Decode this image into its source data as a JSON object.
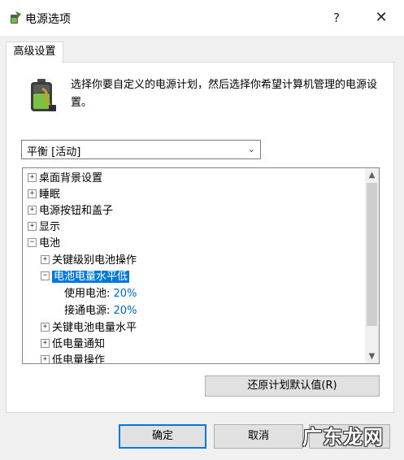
{
  "window": {
    "title": "电源选项",
    "help_label": "?",
    "close_label": "✕"
  },
  "tabs": [
    {
      "label": "高级设置"
    }
  ],
  "description": "选择你要自定义的电源计划，然后选择你希望计算机管理的电源设置。",
  "plan_select": {
    "value": "平衡 [活动]"
  },
  "tree": {
    "items": [
      {
        "label": "桌面背景设置",
        "toggle": "+"
      },
      {
        "label": "睡眠",
        "toggle": "+"
      },
      {
        "label": "电源按钮和盖子",
        "toggle": "+"
      },
      {
        "label": "显示",
        "toggle": "+"
      },
      {
        "label": "电池",
        "toggle": "−"
      },
      {
        "label": "关键级别电池操作",
        "toggle": "+"
      },
      {
        "label": "电池电量水平低",
        "toggle": "−"
      },
      {
        "label": "使用电池:",
        "value": "20%"
      },
      {
        "label": "接通电源:",
        "value": "20%"
      },
      {
        "label": "关键电池电量水平",
        "toggle": "+"
      },
      {
        "label": "低电量通知",
        "toggle": "+"
      },
      {
        "label": "低电量操作",
        "toggle": "+"
      }
    ]
  },
  "buttons": {
    "restore": "还原计划默认值(R)",
    "ok": "确定",
    "cancel": "取消"
  },
  "watermark": "广东龙网",
  "colors": {
    "selection": "#0078d7",
    "value_link": "#0066cc"
  }
}
